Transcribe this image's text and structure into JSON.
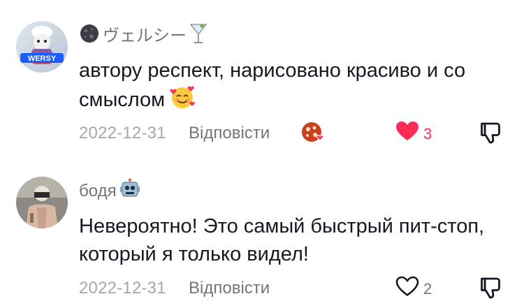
{
  "comments": [
    {
      "username": "ヴェルシー",
      "avatar_badge": "WERSY",
      "text": "автору респект, нарисовано красиво и со смыслом",
      "date": "2022-12-31",
      "reply_label": "Відповісти",
      "likes": "3",
      "liked": true
    },
    {
      "username": "бодя",
      "text": "Невероятно! Это самый быстрый пит-стоп, который я только видел!",
      "date": "2022-12-31",
      "reply_label": "Відповісти",
      "likes": "2",
      "liked": false
    }
  ],
  "colors": {
    "like_active": "#fe2c55",
    "meta_grey": "#a7a7ab",
    "username_grey": "#73747b",
    "text": "#161823"
  }
}
